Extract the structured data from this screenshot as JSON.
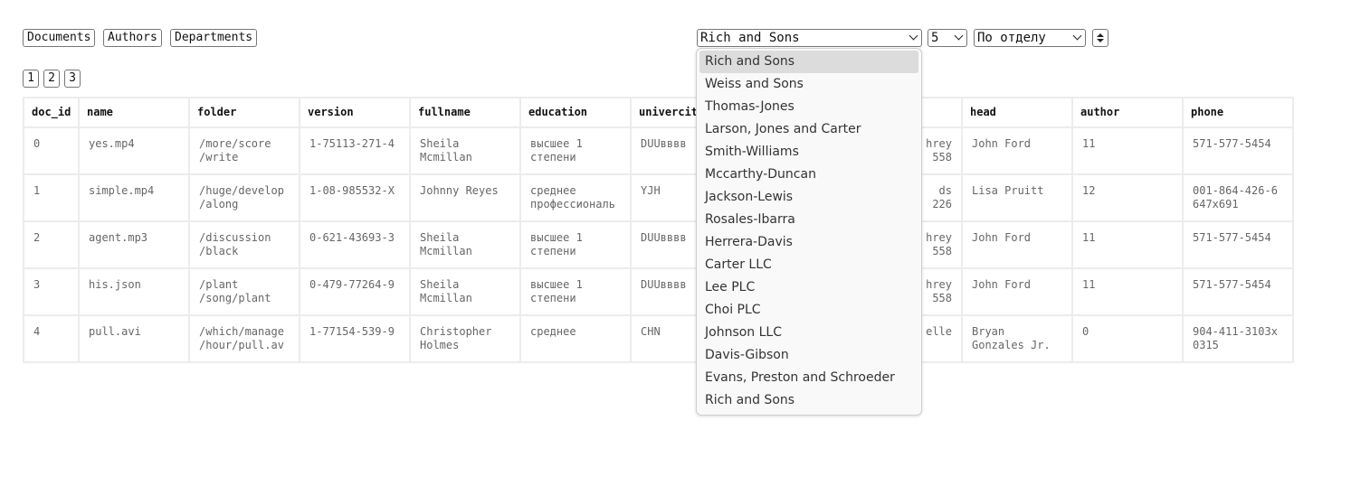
{
  "nav": {
    "documents": "Documents",
    "authors": "Authors",
    "departments": "Departments"
  },
  "pagination": [
    "1",
    "2",
    "3"
  ],
  "filters": {
    "company_value": "Rich and Sons",
    "limit_value": "5",
    "group_value": "По отделу"
  },
  "table": {
    "columns": [
      "doc_id",
      "name",
      "folder",
      "version",
      "fullname",
      "education",
      "univercit",
      "",
      "head",
      "author",
      "phone"
    ],
    "rows": [
      [
        "0",
        "yes.mp4",
        "/more/score\n/write",
        "1-75113-271-4",
        "Sheila\nMcmillan",
        "высшее 1\nстепени",
        "DUUвввв",
        "hrey\n558",
        "John Ford",
        "11",
        "571-577-5454"
      ],
      [
        "1",
        "simple.mp4",
        "/huge/develop\n/along",
        "1-08-985532-X",
        "Johnny Reyes",
        "среднее\nпрофессиональ",
        "YJH",
        "ds\n226",
        "Lisa Pruitt",
        "12",
        "001-864-426-6\n647x691"
      ],
      [
        "2",
        "agent.mp3",
        "/discussion\n/black",
        "0-621-43693-3",
        "Sheila\nMcmillan",
        "высшее 1\nстепени",
        "DUUвввв",
        "hrey\n558",
        "John Ford",
        "11",
        "571-577-5454"
      ],
      [
        "3",
        "his.json",
        "/plant\n/song/plant",
        "0-479-77264-9",
        "Sheila\nMcmillan",
        "высшее 1\nстепени",
        "DUUвввв",
        "hrey\n558",
        "John Ford",
        "11",
        "571-577-5454"
      ],
      [
        "4",
        "pull.avi",
        "/which/manage\n/hour/pull.av",
        "1-77154-539-9",
        "Christopher\nHolmes",
        "среднее",
        "CHN",
        "elle",
        "Bryan\nGonzales Jr.",
        "0",
        "904-411-3103x\n0315"
      ]
    ]
  },
  "dropdown_options": [
    "Rich and Sons",
    "Weiss and Sons",
    "Thomas-Jones",
    "Larson, Jones and Carter",
    "Smith-Williams",
    "Mccarthy-Duncan",
    "Jackson-Lewis",
    "Rosales-Ibarra",
    "Herrera-Davis",
    "Carter LLC",
    "Lee PLC",
    "Choi PLC",
    "Johnson LLC",
    "Davis-Gibson",
    "Evans, Preston and Schroeder",
    "Rich and Sons"
  ]
}
